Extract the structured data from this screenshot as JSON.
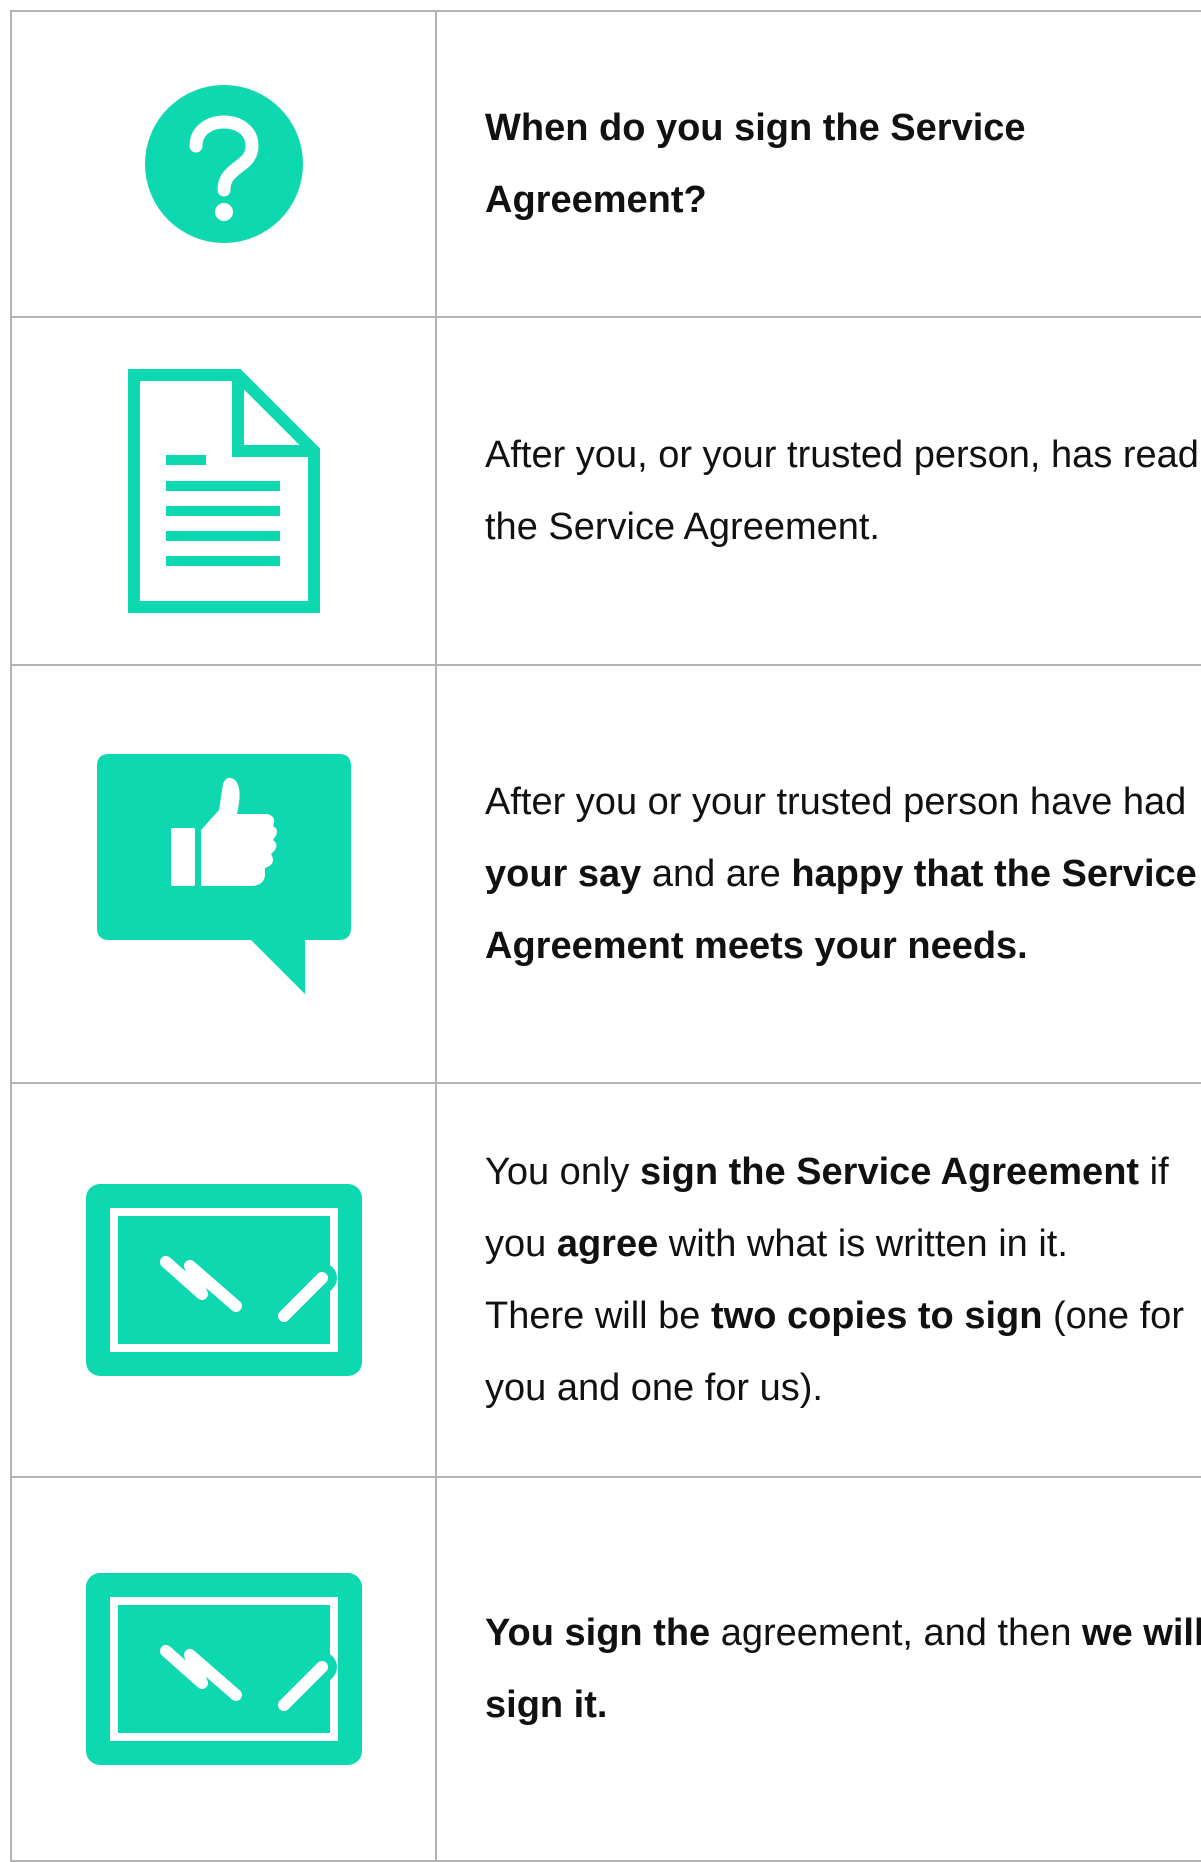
{
  "brand_color": "#0dd8b0",
  "rows": [
    {
      "icon": "question-icon",
      "parts": [
        {
          "text": "When do you sign the Service Agreement?",
          "bold": true
        }
      ]
    },
    {
      "icon": "document-icon",
      "parts": [
        {
          "text": "After you, or your trusted person, has read the Service Agreement.",
          "bold": false
        }
      ]
    },
    {
      "icon": "thumbs-up-speech-bubble-icon",
      "parts": [
        {
          "text": "After you or your trusted person have had ",
          "bold": false
        },
        {
          "text": "your say",
          "bold": true
        },
        {
          "text": " and are ",
          "bold": false
        },
        {
          "text": "happy that the Service Agreement meets your needs.",
          "bold": true
        }
      ]
    },
    {
      "icon": "signature-icon",
      "parts": [
        {
          "text": "You only ",
          "bold": false
        },
        {
          "text": "sign the Service Agreement",
          "bold": true
        },
        {
          "text": " if you ",
          "bold": false
        },
        {
          "text": "agree",
          "bold": true
        },
        {
          "text": " with what is written in it.",
          "bold": false
        }
      ],
      "parts2": [
        {
          "text": "There will be ",
          "bold": false
        },
        {
          "text": "two copies to sign",
          "bold": true
        },
        {
          "text": " (one for you and one for us).",
          "bold": false
        }
      ]
    },
    {
      "icon": "signature-icon",
      "parts": [
        {
          "text": "You sign the",
          "bold": true
        },
        {
          "text": " agreement, and then ",
          "bold": false
        },
        {
          "text": "we will sign it.",
          "bold": true
        }
      ]
    }
  ]
}
